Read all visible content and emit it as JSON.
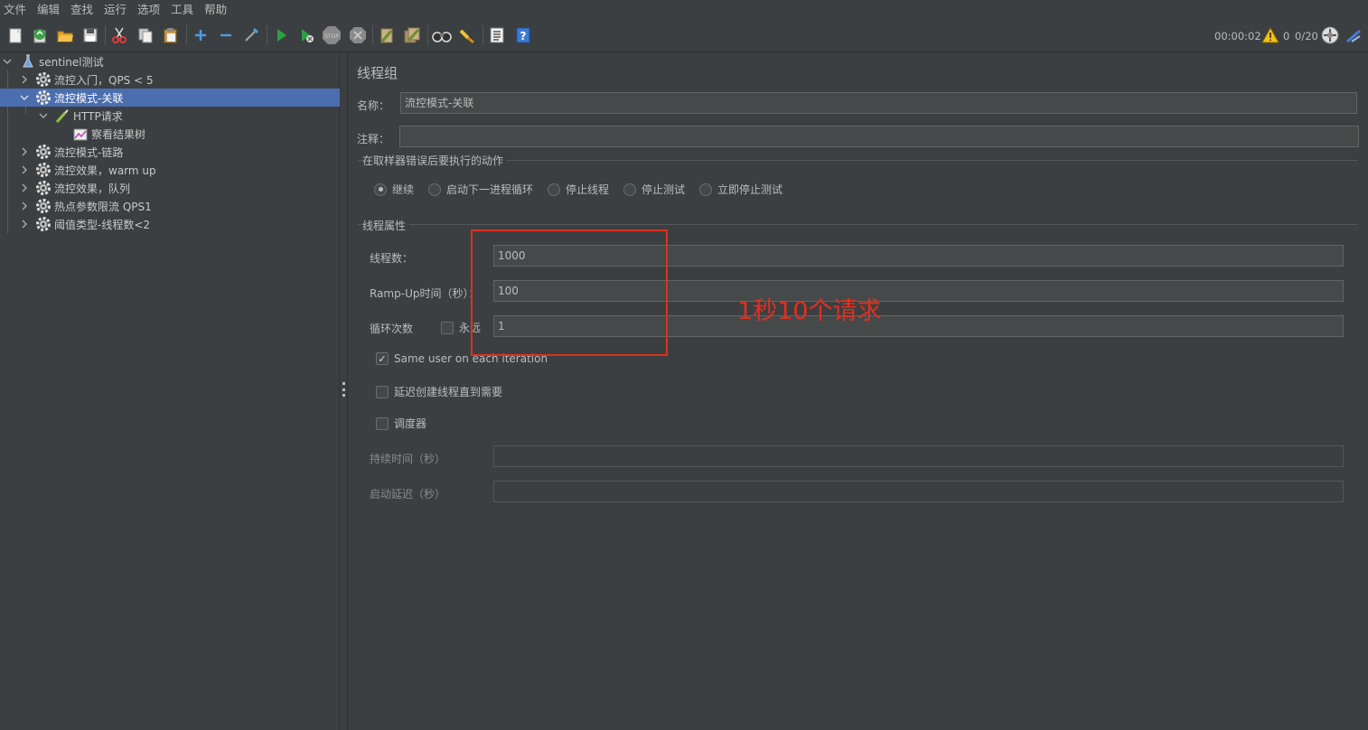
{
  "menubar": {
    "items": [
      "文件",
      "编辑",
      "查找",
      "运行",
      "选项",
      "工具",
      "帮助"
    ]
  },
  "toolbar": {
    "icons": [
      "new-icon",
      "templates-icon",
      "open-icon",
      "save-icon",
      "cut-icon",
      "copy-icon",
      "paste-icon",
      "expand-icon",
      "collapse-icon",
      "toggle-icon",
      "start-icon",
      "start-no-pause-icon",
      "stop-icon",
      "shutdown-icon",
      "clear-icon",
      "clear-all-icon",
      "search-icon",
      "reset-search-icon",
      "function-helper-icon",
      "help-icon"
    ],
    "elapsed": "00:00:02",
    "warnings": "0",
    "threads": "0/20"
  },
  "tree": {
    "items": [
      {
        "label": "sentinel测试",
        "icon": "flask-icon"
      },
      {
        "label": "流控入门，QPS < 5",
        "icon": "gear-icon"
      },
      {
        "label": "流控模式-关联",
        "icon": "gear-icon"
      },
      {
        "label": "HTTP请求",
        "icon": "pipette-icon"
      },
      {
        "label": "察看结果树",
        "icon": "chart-icon"
      },
      {
        "label": "流控模式-链路",
        "icon": "gear-icon"
      },
      {
        "label": "流控效果，warm up",
        "icon": "gear-icon"
      },
      {
        "label": "流控效果，队列",
        "icon": "gear-icon"
      },
      {
        "label": "热点参数限流 QPS1",
        "icon": "gear-icon"
      },
      {
        "label": "阈值类型-线程数<2",
        "icon": "gear-icon"
      }
    ]
  },
  "panel": {
    "title": "线程组",
    "name_label": "名称：",
    "name_value": "流控模式-关联",
    "comment_label": "注释：",
    "comment_value": "",
    "error_group_title": "在取样器错误后要执行的动作",
    "error_options": [
      "继续",
      "启动下一进程循环",
      "停止线程",
      "停止测试",
      "立即停止测试"
    ],
    "error_selected": "继续",
    "thread_group_title": "线程属性",
    "threads_label": "线程数：",
    "threads_value": "1000",
    "rampup_label": "Ramp-Up时间（秒）：",
    "rampup_value": "100",
    "loop_label": "循环次数",
    "forever_label": "永远",
    "loop_value": "1",
    "same_user_label": "Same user on each iteration",
    "same_user_checked": true,
    "delay_label": "延迟创建线程直到需要",
    "scheduler_label": "调度器",
    "duration_label": "持续时间（秒）",
    "duration_value": "",
    "startup_delay_label": "启动延迟（秒）",
    "startup_delay_value": ""
  },
  "annotation": {
    "text": "1秒10个请求",
    "color": "#e0301e"
  }
}
